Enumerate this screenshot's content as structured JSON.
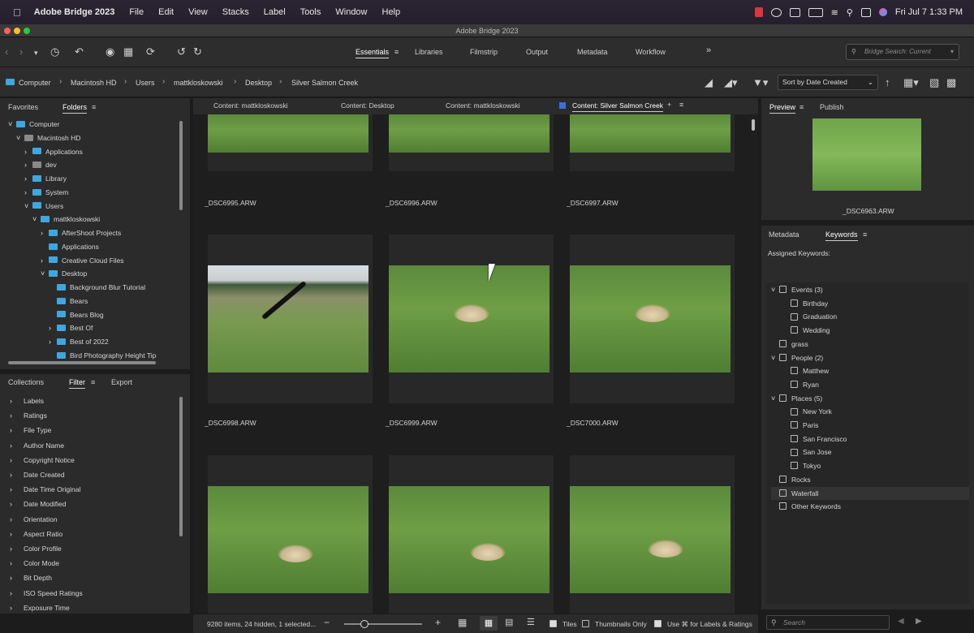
{
  "menubar": {
    "app_name": "Adobe Bridge 2023",
    "items": [
      "File",
      "Edit",
      "View",
      "Stacks",
      "Label",
      "Tools",
      "Window",
      "Help"
    ],
    "clock": "Fri Jul 7  1:33 PM"
  },
  "window": {
    "title": "Adobe Bridge 2023"
  },
  "toolbar": {
    "workspaces": [
      "Essentials",
      "Libraries",
      "Filmstrip",
      "Output",
      "Metadata",
      "Workflow"
    ],
    "active_workspace": "Essentials",
    "more": "»",
    "search_placeholder": "Bridge Search: Current"
  },
  "pathbar": {
    "crumbs": [
      "Computer",
      "Macintosh HD",
      "Users",
      "mattkloskowski",
      "Desktop",
      "Silver Salmon Creek"
    ],
    "sort_label": "Sort by Date Created"
  },
  "left_top": {
    "tabs": [
      "Favorites",
      "Folders"
    ],
    "tree": [
      {
        "label": "Computer",
        "depth": 0,
        "arrow": "open",
        "icon": "blue"
      },
      {
        "label": "Macintosh HD",
        "depth": 1,
        "arrow": "open",
        "icon": "gray"
      },
      {
        "label": "Applications",
        "depth": 2,
        "arrow": "closed",
        "icon": "blue"
      },
      {
        "label": "dev",
        "depth": 2,
        "arrow": "closed",
        "icon": "gray"
      },
      {
        "label": "Library",
        "depth": 2,
        "arrow": "closed",
        "icon": "blue"
      },
      {
        "label": "System",
        "depth": 2,
        "arrow": "closed",
        "icon": "blue"
      },
      {
        "label": "Users",
        "depth": 2,
        "arrow": "open",
        "icon": "blue"
      },
      {
        "label": "mattkloskowski",
        "depth": 3,
        "arrow": "open",
        "icon": "blue"
      },
      {
        "label": "AfterShoot Projects",
        "depth": 4,
        "arrow": "closed",
        "icon": "blue"
      },
      {
        "label": "Applications",
        "depth": 4,
        "arrow": "",
        "icon": "blue"
      },
      {
        "label": "Creative Cloud Files",
        "depth": 4,
        "arrow": "closed",
        "icon": "blue"
      },
      {
        "label": "Desktop",
        "depth": 4,
        "arrow": "open",
        "icon": "blue"
      },
      {
        "label": "Background Blur Tutorial",
        "depth": 5,
        "arrow": "",
        "icon": "blue"
      },
      {
        "label": "Bears",
        "depth": 5,
        "arrow": "",
        "icon": "blue"
      },
      {
        "label": "Bears Blog",
        "depth": 5,
        "arrow": "",
        "icon": "blue"
      },
      {
        "label": "Best Of",
        "depth": 5,
        "arrow": "closed",
        "icon": "blue"
      },
      {
        "label": "Best of 2022",
        "depth": 5,
        "arrow": "closed",
        "icon": "blue"
      },
      {
        "label": "Bird Photography Height Tip",
        "depth": 5,
        "arrow": "",
        "icon": "blue"
      }
    ]
  },
  "left_bottom": {
    "tabs": [
      "Collections",
      "Filter",
      "Export"
    ],
    "filters": [
      "Labels",
      "Ratings",
      "File Type",
      "Author Name",
      "Copyright Notice",
      "Date Created",
      "Date Time Original",
      "Date Modified",
      "Orientation",
      "Aspect Ratio",
      "Color Profile",
      "Color Mode",
      "Bit Depth",
      "ISO Speed Ratings",
      "Exposure Time"
    ]
  },
  "content": {
    "tabs": [
      "Content: mattkloskowski",
      "Content: Desktop",
      "Content: mattkloskowski",
      "Content: Silver Salmon Creek"
    ],
    "files": [
      "_DSC6995.ARW",
      "_DSC6996.ARW",
      "_DSC6997.ARW",
      "_DSC6998.ARW",
      "_DSC6999.ARW",
      "_DSC7000.ARW",
      "",
      "",
      ""
    ]
  },
  "status": {
    "summary": "9280 items, 24 hidden, 1 selected...",
    "tiles": "Tiles",
    "thumbs_only": "Thumbnails Only",
    "use_cmd": "Use ⌘ for Labels & Ratings"
  },
  "preview": {
    "tabs": [
      "Preview",
      "Publish"
    ],
    "filename": "_DSC6963.ARW"
  },
  "keywords": {
    "tabs": [
      "Metadata",
      "Keywords"
    ],
    "assigned_label": "Assigned Keywords:",
    "items": [
      {
        "label": "Events  (3)",
        "depth": 0,
        "arrow": "open"
      },
      {
        "label": "Birthday",
        "depth": 1,
        "arrow": ""
      },
      {
        "label": "Graduation",
        "depth": 1,
        "arrow": ""
      },
      {
        "label": "Wedding",
        "depth": 1,
        "arrow": ""
      },
      {
        "label": "grass",
        "depth": 0,
        "arrow": ""
      },
      {
        "label": "People  (2)",
        "depth": 0,
        "arrow": "open"
      },
      {
        "label": "Matthew",
        "depth": 1,
        "arrow": ""
      },
      {
        "label": "Ryan",
        "depth": 1,
        "arrow": ""
      },
      {
        "label": "Places  (5)",
        "depth": 0,
        "arrow": "open"
      },
      {
        "label": "New York",
        "depth": 1,
        "arrow": ""
      },
      {
        "label": "Paris",
        "depth": 1,
        "arrow": ""
      },
      {
        "label": "San Francisco",
        "depth": 1,
        "arrow": ""
      },
      {
        "label": "San Jose",
        "depth": 1,
        "arrow": ""
      },
      {
        "label": "Tokyo",
        "depth": 1,
        "arrow": ""
      },
      {
        "label": "Rocks",
        "depth": 0,
        "arrow": ""
      },
      {
        "label": "Waterfall",
        "depth": 0,
        "arrow": ""
      },
      {
        "label": "Other Keywords",
        "depth": 0,
        "arrow": ""
      }
    ],
    "search_placeholder": "Search"
  }
}
